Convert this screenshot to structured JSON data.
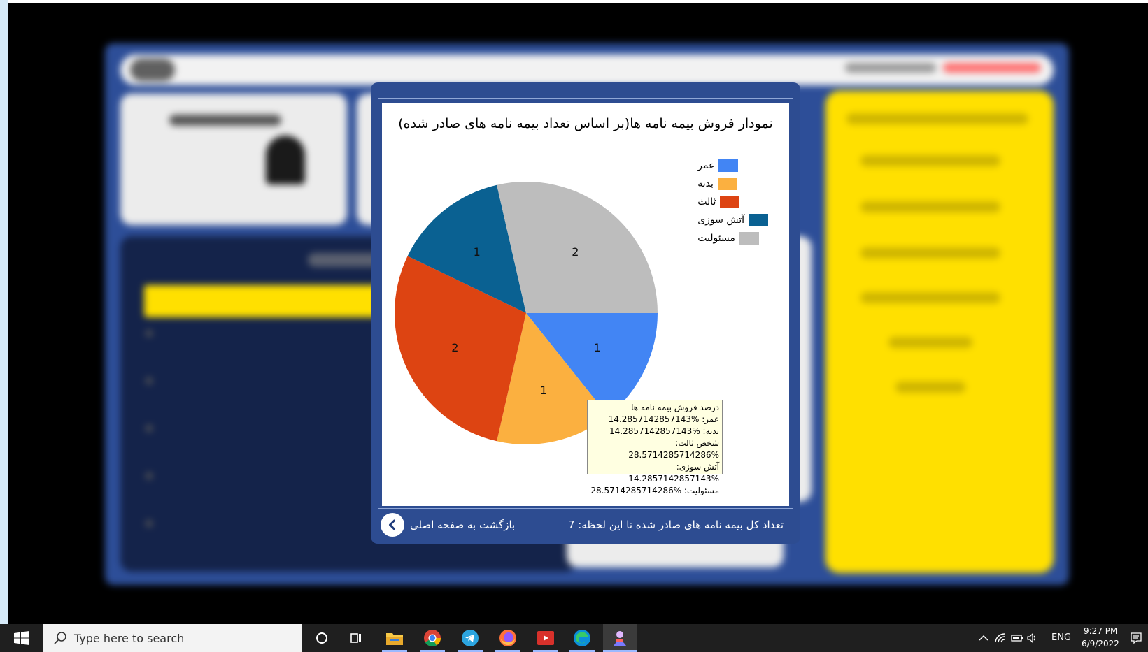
{
  "chart_title": "نمودار فروش بیمه نامه ها(بر اساس تعداد بیمه نامه های صادر شده)",
  "legend": [
    {
      "label": "عمر",
      "color": "#4285f4"
    },
    {
      "label": "بدنه",
      "color": "#fbb040"
    },
    {
      "label": "ثالث",
      "color": "#dd4412"
    },
    {
      "label": "آتش سوزی",
      "color": "#0a6192"
    },
    {
      "label": "مسئولیت",
      "color": "#bdbdbd"
    }
  ],
  "chart_data": {
    "type": "pie",
    "title": "نمودار فروش بیمه نامه ها(بر اساس تعداد بیمه نامه های صادر شده)",
    "categories": [
      "عمر",
      "بدنه",
      "ثالث",
      "آتش سوزی",
      "مسئولیت"
    ],
    "values": [
      1,
      1,
      2,
      1,
      2
    ],
    "colors": [
      "#4285f4",
      "#fbb040",
      "#dd4412",
      "#0a6192",
      "#bdbdbd"
    ],
    "legend_position": "top-right"
  },
  "tooltip": {
    "title": "درصد فروش بیمه نامه ها",
    "lines": [
      "عمر: %14.2857142857143",
      "بدنه: %14.2857142857143",
      "شخص ثالث: %28.5714285714286",
      "آتش سوزی: %14.2857142857143",
      "مسئولیت: %28.5714285714286"
    ]
  },
  "footer": {
    "total_label": "تعداد کل بیمه نامه های صادر شده تا این لحظه:",
    "total_value": "7",
    "back_label": "بازگشت به صفحه اصلی",
    "back_icon": "chevron-left-icon"
  },
  "taskbar": {
    "search_placeholder": "Type here to search",
    "language": "ENG",
    "time": "9:27 PM",
    "date": "6/9/2022"
  }
}
